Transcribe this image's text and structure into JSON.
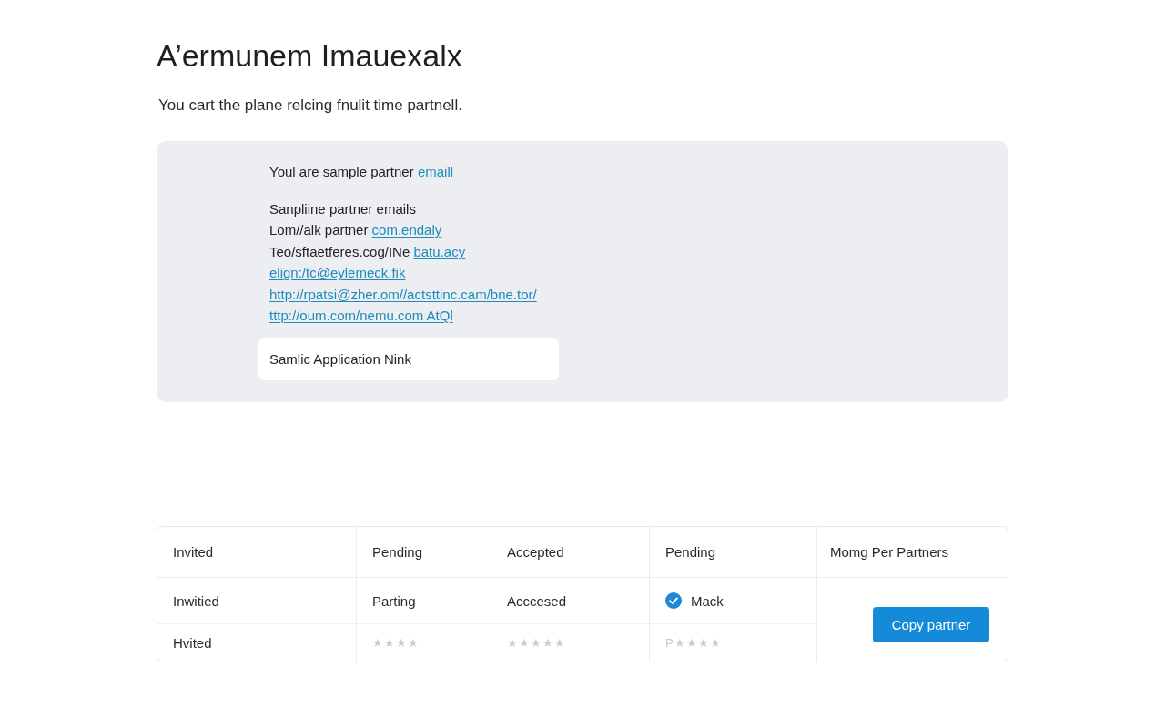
{
  "page": {
    "title": "A’ermunem Imauexalx",
    "subtitle": "You cart the plane relcing fnulit time partnell."
  },
  "card": {
    "intro": {
      "text": "Youl are sample partner",
      "link": "emaill"
    },
    "lines": [
      {
        "text": "Sanpliine partner emails"
      },
      {
        "text": "Lom//alk partner",
        "link": "com.endaly"
      },
      {
        "text": "Teo/sftaetferes.cog/INe",
        "link": "batu.acy"
      },
      {
        "link": "elign:/tc@eylemeck.fik"
      },
      {
        "link": "http://rpatsi@zher.om//actsttinc.cam/bne.tor/"
      },
      {
        "link": "tttp://oum.com/nemu.com AtQl"
      }
    ],
    "field": {
      "value": "Samlic Application Nink"
    }
  },
  "table": {
    "columns": [
      "Invited",
      "Pending",
      "Accepted",
      "Pending",
      "Momg Per Partners"
    ],
    "rows": [
      [
        {
          "kind": "text",
          "text": "Inwitied"
        },
        {
          "kind": "text",
          "text": "Parting"
        },
        {
          "kind": "text",
          "text": "Acccesed"
        },
        {
          "kind": "check",
          "text": "Mack",
          "checked": true
        }
      ],
      [
        {
          "kind": "text",
          "text": "Hvited"
        },
        {
          "kind": "muted",
          "text": "★★★★"
        },
        {
          "kind": "muted",
          "text": "★★★★★"
        },
        {
          "kind": "muted",
          "text": "P★★★★"
        }
      ]
    ],
    "button": "Copy partner"
  }
}
